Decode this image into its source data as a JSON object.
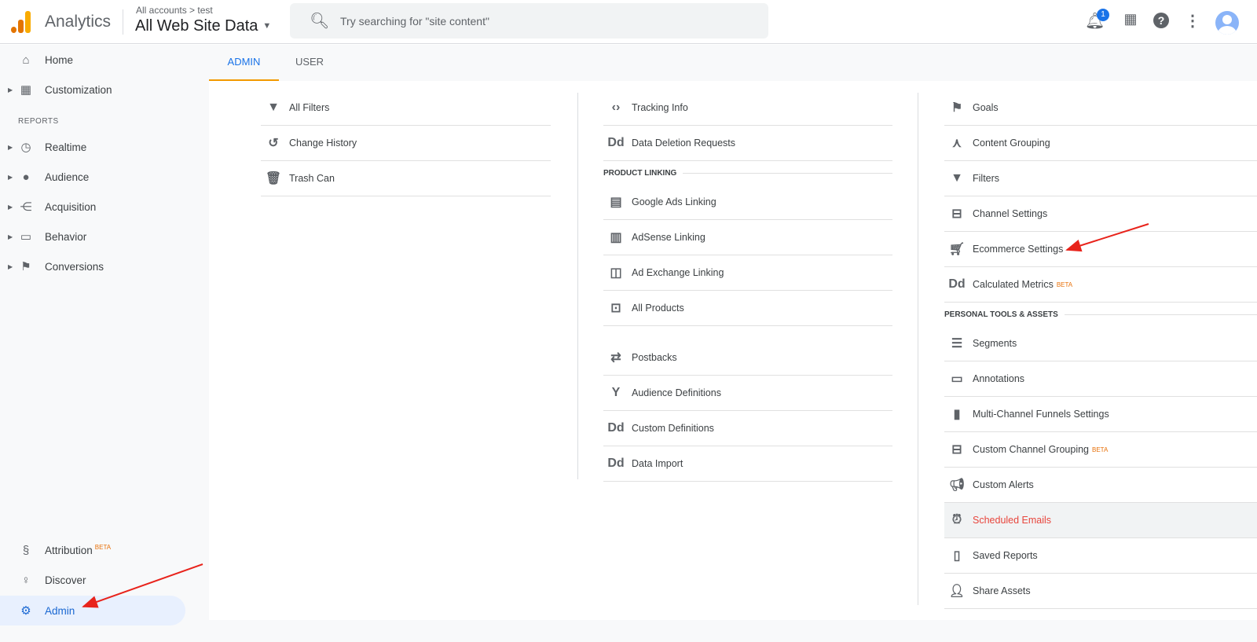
{
  "header": {
    "app_name": "Analytics",
    "breadcrumb": "All accounts > test",
    "property": "All Web Site Data",
    "search_placeholder": "Try searching for \"site content\"",
    "notification_count": "1"
  },
  "sidebar": {
    "items": [
      {
        "label": "Home",
        "icon": "home-icon"
      },
      {
        "label": "Customization",
        "icon": "dashboard-icon"
      }
    ],
    "reports_label": "REPORTS",
    "reports": [
      {
        "label": "Realtime",
        "icon": "clock-icon"
      },
      {
        "label": "Audience",
        "icon": "person-icon"
      },
      {
        "label": "Acquisition",
        "icon": "acquisition-icon"
      },
      {
        "label": "Behavior",
        "icon": "behavior-icon"
      },
      {
        "label": "Conversions",
        "icon": "flag-icon"
      }
    ],
    "bottom": [
      {
        "label": "Attribution",
        "badge": "BETA",
        "icon": "attribution-icon"
      },
      {
        "label": "Discover",
        "icon": "lightbulb-icon"
      },
      {
        "label": "Admin",
        "icon": "gear-icon"
      }
    ]
  },
  "tabs": [
    {
      "label": "ADMIN"
    },
    {
      "label": "USER"
    }
  ],
  "columns": [
    [
      {
        "label": "All Filters",
        "icon": "filter-icon"
      },
      {
        "label": "Change History",
        "icon": "history-icon"
      },
      {
        "label": "Trash Can",
        "icon": "trash-icon"
      }
    ],
    [
      {
        "label": "Tracking Info",
        "icon": "code-icon"
      },
      {
        "label": "Data Deletion Requests",
        "icon": "dd-icon"
      },
      {
        "section": "PRODUCT LINKING"
      },
      {
        "label": "Google Ads Linking",
        "icon": "ads-icon"
      },
      {
        "label": "AdSense Linking",
        "icon": "adsense-icon"
      },
      {
        "label": "Ad Exchange Linking",
        "icon": "adexchange-icon"
      },
      {
        "label": "All Products",
        "icon": "link-icon"
      },
      {
        "spacer": true
      },
      {
        "label": "Postbacks",
        "icon": "postback-icon"
      },
      {
        "label": "Audience Definitions",
        "icon": "audience-icon"
      },
      {
        "label": "Custom Definitions",
        "icon": "dd-icon"
      },
      {
        "label": "Data Import",
        "icon": "dd-icon"
      }
    ],
    [
      {
        "label": "Goals",
        "icon": "flag-icon"
      },
      {
        "label": "Content Grouping",
        "icon": "grouping-icon"
      },
      {
        "label": "Filters",
        "icon": "filter-icon"
      },
      {
        "label": "Channel Settings",
        "icon": "channel-icon"
      },
      {
        "label": "Ecommerce Settings",
        "icon": "cart-icon"
      },
      {
        "label": "Calculated Metrics",
        "badge": "BETA",
        "icon": "dd-icon"
      },
      {
        "section": "PERSONAL TOOLS & ASSETS"
      },
      {
        "label": "Segments",
        "icon": "segments-icon"
      },
      {
        "label": "Annotations",
        "icon": "annotation-icon"
      },
      {
        "label": "Multi-Channel Funnels Settings",
        "icon": "bar-chart-icon"
      },
      {
        "label": "Custom Channel Grouping",
        "badge": "BETA",
        "icon": "channel-icon"
      },
      {
        "label": "Custom Alerts",
        "icon": "megaphone-icon"
      },
      {
        "label": "Scheduled Emails",
        "icon": "alarm-icon",
        "highlighted": true
      },
      {
        "label": "Saved Reports",
        "icon": "document-icon"
      },
      {
        "label": "Share Assets",
        "icon": "person-add-icon"
      }
    ]
  ],
  "colors": {
    "accent": "#1a73e8",
    "tab_indicator": "#f29900",
    "arrow": "#e8231b",
    "highlight_text": "#e8453c"
  }
}
